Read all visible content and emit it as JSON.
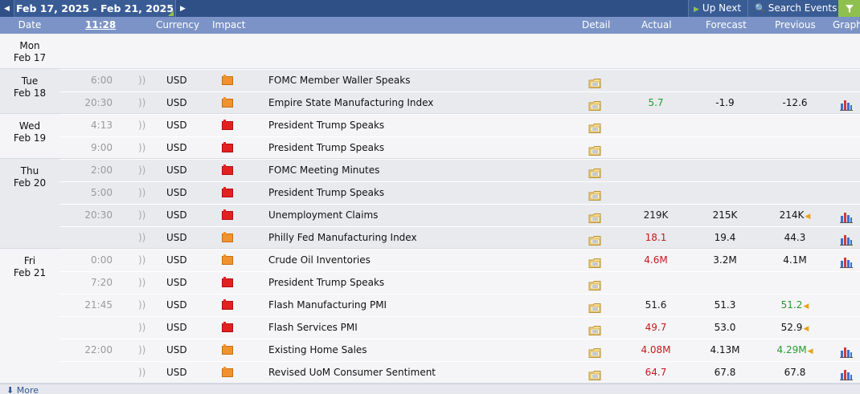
{
  "nav": {
    "prev_icon": "chevron-left-icon",
    "range": "Feb 17, 2025 - Feb 21, 2025",
    "next_icon": "chevron-right-icon",
    "up_next": "Up Next",
    "search_events": "Search Events",
    "filter_icon": "filter-icon"
  },
  "columns": {
    "date": "Date",
    "time": "11:28",
    "currency": "Currency",
    "impact": "Impact",
    "detail": "Detail",
    "actual": "Actual",
    "forecast": "Forecast",
    "previous": "Previous",
    "graph": "Graph"
  },
  "days": [
    {
      "weekday": "Mon",
      "date": "Feb 17",
      "events": []
    },
    {
      "weekday": "Tue",
      "date": "Feb 18",
      "events": [
        {
          "time": "6:00",
          "currency": "USD",
          "impact": "medium",
          "title": "FOMC Member Waller Speaks",
          "actual": "",
          "actual_class": "",
          "forecast": "",
          "previous": "",
          "previous_class": "",
          "revised": false,
          "graph": false
        },
        {
          "time": "20:30",
          "currency": "USD",
          "impact": "medium",
          "title": "Empire State Manufacturing Index",
          "actual": "5.7",
          "actual_class": "good",
          "forecast": "-1.9",
          "previous": "-12.6",
          "previous_class": "",
          "revised": false,
          "graph": true
        }
      ]
    },
    {
      "weekday": "Wed",
      "date": "Feb 19",
      "events": [
        {
          "time": "4:13",
          "currency": "USD",
          "impact": "high",
          "title": "President Trump Speaks",
          "actual": "",
          "actual_class": "",
          "forecast": "",
          "previous": "",
          "previous_class": "",
          "revised": false,
          "graph": false
        },
        {
          "time": "9:00",
          "currency": "USD",
          "impact": "high",
          "title": "President Trump Speaks",
          "actual": "",
          "actual_class": "",
          "forecast": "",
          "previous": "",
          "previous_class": "",
          "revised": false,
          "graph": false
        }
      ]
    },
    {
      "weekday": "Thu",
      "date": "Feb 20",
      "events": [
        {
          "time": "2:00",
          "currency": "USD",
          "impact": "high",
          "title": "FOMC Meeting Minutes",
          "actual": "",
          "actual_class": "",
          "forecast": "",
          "previous": "",
          "previous_class": "",
          "revised": false,
          "graph": false
        },
        {
          "time": "5:00",
          "currency": "USD",
          "impact": "high",
          "title": "President Trump Speaks",
          "actual": "",
          "actual_class": "",
          "forecast": "",
          "previous": "",
          "previous_class": "",
          "revised": false,
          "graph": false
        },
        {
          "time": "20:30",
          "currency": "USD",
          "impact": "high",
          "title": "Unemployment Claims",
          "actual": "219K",
          "actual_class": "",
          "forecast": "215K",
          "previous": "214K",
          "previous_class": "",
          "revised": true,
          "graph": true
        },
        {
          "time": "",
          "currency": "USD",
          "impact": "medium",
          "title": "Philly Fed Manufacturing Index",
          "actual": "18.1",
          "actual_class": "bad",
          "forecast": "19.4",
          "previous": "44.3",
          "previous_class": "",
          "revised": false,
          "graph": true
        }
      ]
    },
    {
      "weekday": "Fri",
      "date": "Feb 21",
      "events": [
        {
          "time": "0:00",
          "currency": "USD",
          "impact": "medium",
          "title": "Crude Oil Inventories",
          "actual": "4.6M",
          "actual_class": "bad",
          "forecast": "3.2M",
          "previous": "4.1M",
          "previous_class": "",
          "revised": false,
          "graph": true
        },
        {
          "time": "7:20",
          "currency": "USD",
          "impact": "high",
          "title": "President Trump Speaks",
          "actual": "",
          "actual_class": "",
          "forecast": "",
          "previous": "",
          "previous_class": "",
          "revised": false,
          "graph": false
        },
        {
          "time": "21:45",
          "currency": "USD",
          "impact": "high",
          "title": "Flash Manufacturing PMI",
          "actual": "51.6",
          "actual_class": "",
          "forecast": "51.3",
          "previous": "51.2",
          "previous_class": "good",
          "revised": true,
          "graph": false
        },
        {
          "time": "",
          "currency": "USD",
          "impact": "high",
          "title": "Flash Services PMI",
          "actual": "49.7",
          "actual_class": "bad",
          "forecast": "53.0",
          "previous": "52.9",
          "previous_class": "",
          "revised": true,
          "graph": false
        },
        {
          "time": "22:00",
          "currency": "USD",
          "impact": "medium",
          "title": "Existing Home Sales",
          "actual": "4.08M",
          "actual_class": "bad",
          "forecast": "4.13M",
          "previous": "4.29M",
          "previous_class": "good",
          "revised": true,
          "graph": true
        },
        {
          "time": "",
          "currency": "USD",
          "impact": "medium",
          "title": "Revised UoM Consumer Sentiment",
          "actual": "64.7",
          "actual_class": "bad",
          "forecast": "67.8",
          "previous": "67.8",
          "previous_class": "",
          "revised": false,
          "graph": true
        }
      ]
    }
  ],
  "footer": {
    "more": "More"
  },
  "colors": {
    "nav_bg": "#2f4f87",
    "header_bg": "#7b93c6",
    "accent_green": "#8fc04f",
    "impact_high": "#e32020",
    "impact_medium": "#f0922e",
    "better": "#259c2c",
    "worse": "#c21b1b"
  }
}
